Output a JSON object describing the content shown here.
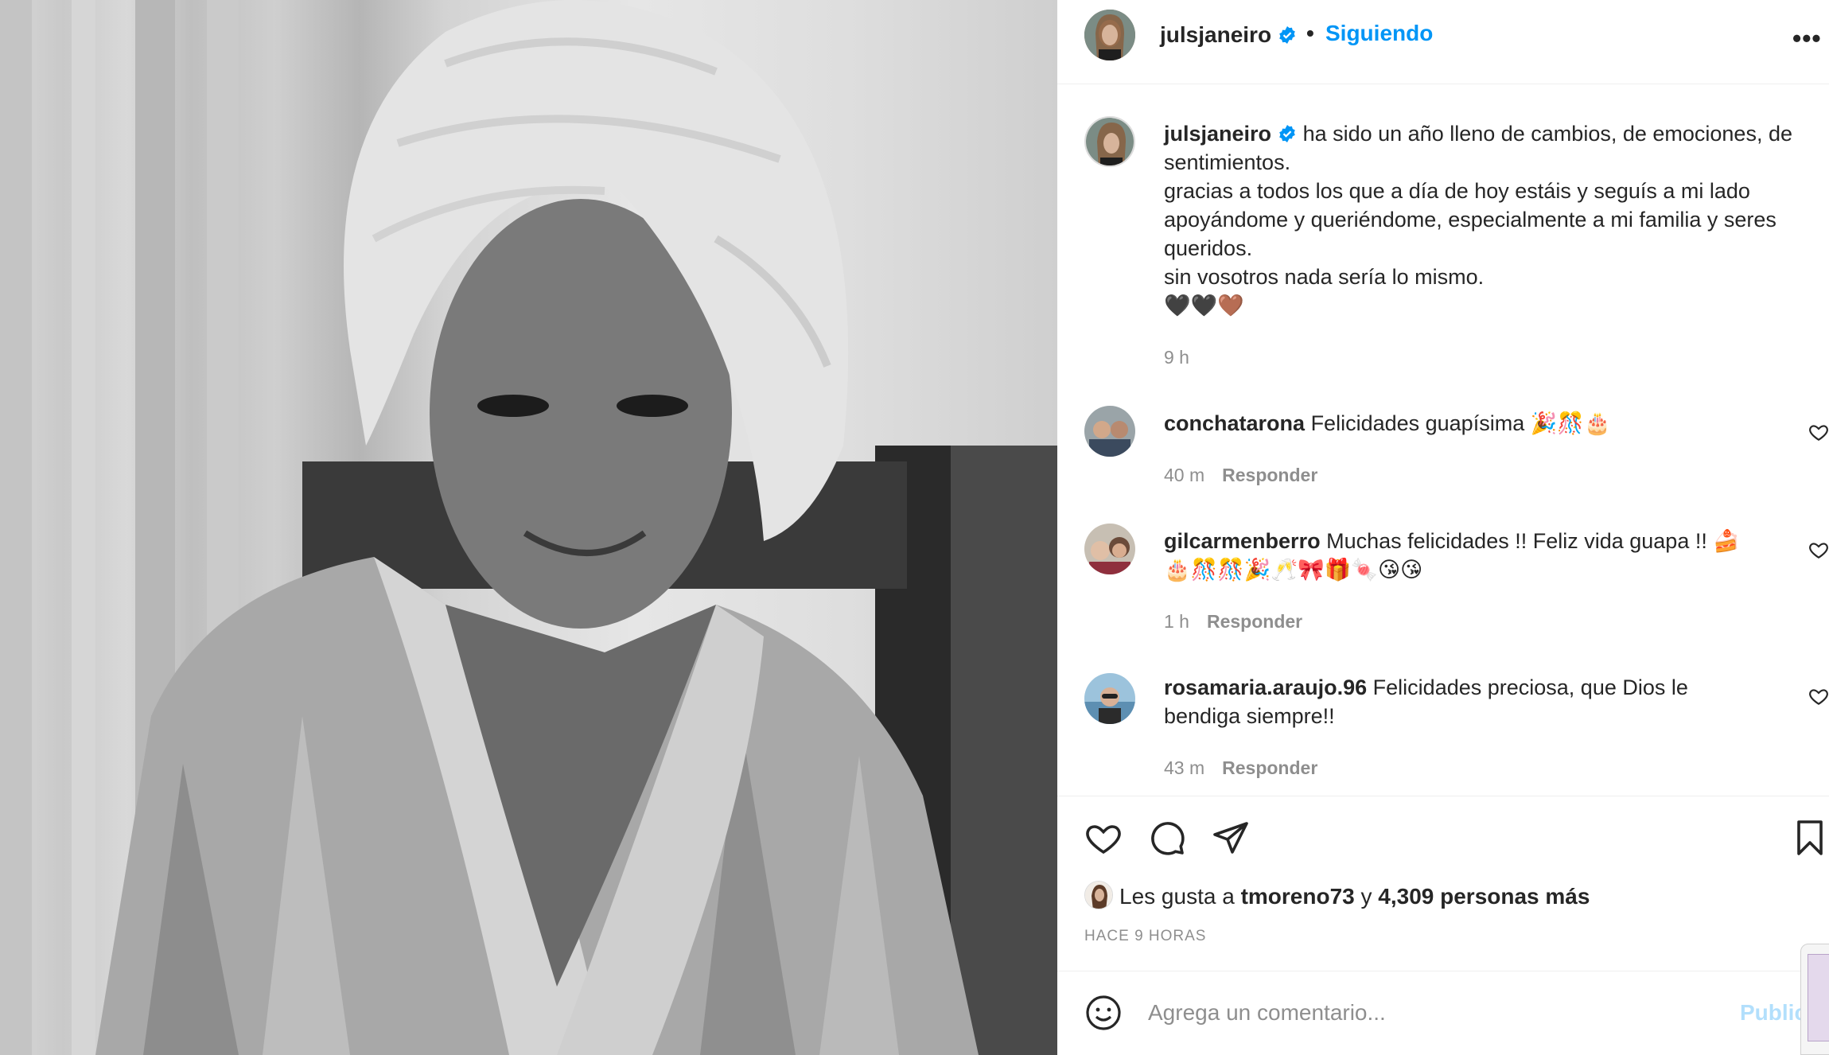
{
  "post": {
    "username": "julsjaneiro",
    "follow_status": "Siguiendo",
    "separator": "•",
    "more_icon": "ellipsis-icon"
  },
  "caption": {
    "username": "julsjaneiro",
    "text_line1": "ha sido un año lleno de cambios, de emociones, de",
    "text_line2": "sentimientos.",
    "text_line3": "gracias a todos los que a día de hoy estáis y seguís a mi lado",
    "text_line4": "apoyándome y queriéndome, especialmente a mi familia y seres",
    "text_line5": "queridos.",
    "text_line6": "sin vosotros nada sería lo mismo.",
    "emoji": "🖤🖤🤎",
    "time": "9 h"
  },
  "comments": [
    {
      "username": "conchatarona",
      "text": "Felicidades guapísima 🎉🎊🎂",
      "time": "40 m",
      "reply": "Responder"
    },
    {
      "username": "gilcarmenberro",
      "text": "Muchas felicidades !! Feliz vida guapa !! 🍰",
      "text2": "🎂🎊🎊🎉🥂🎀🎁🍬😘😘",
      "time": "1 h",
      "reply": "Responder"
    },
    {
      "username": "rosamaria.araujo.96",
      "text": "Felicidades preciosa, que Dios le",
      "text2": "bendiga siempre!!",
      "time": "43 m",
      "reply": "Responder"
    }
  ],
  "likes": {
    "prefix": "Les gusta a",
    "user": "tmoreno73",
    "joiner": "y",
    "others": "4,309 personas más"
  },
  "timestamp": "HACE 9 HORAS",
  "composer": {
    "placeholder": "Agrega un comentario...",
    "publish": "Publicar"
  },
  "colors": {
    "accent": "#0095f6",
    "text": "#262626",
    "muted": "#8e8e8e",
    "publish_disabled": "#b2dffc"
  }
}
